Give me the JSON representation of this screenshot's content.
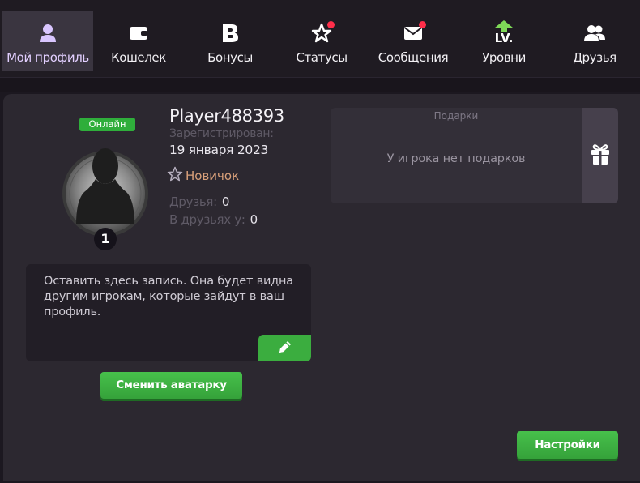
{
  "nav": {
    "items": [
      {
        "label": "Мой профиль",
        "icon": "user-icon",
        "active": true
      },
      {
        "label": "Кошелек",
        "icon": "wallet-icon",
        "active": false
      },
      {
        "label": "Бонусы",
        "icon": "bonus-b-icon",
        "active": false
      },
      {
        "label": "Статусы",
        "icon": "star-icon",
        "active": false,
        "notification": true
      },
      {
        "label": "Сообщения",
        "icon": "envelope-icon",
        "active": false,
        "notification": true
      },
      {
        "label": "Уровни",
        "icon": "level-up-icon",
        "icon_text": "LV.",
        "active": false
      },
      {
        "label": "Друзья",
        "icon": "friends-icon",
        "active": false
      }
    ]
  },
  "profile": {
    "status": "Онлайн",
    "level": "1",
    "name": "Player488393",
    "registered_label": "Зарегистрирован:",
    "registered_date": "19 января 2023",
    "rank": "Новичок",
    "friends_label": "Друзья:",
    "friends_value": "0",
    "friend_of_label": "В друзьях у:",
    "friend_of_value": "0"
  },
  "gifts": {
    "title": "Подарки",
    "empty_text": "У игрока нет подарков"
  },
  "wall": {
    "placeholder": "Оставить здесь запись. Она будет видна другим игрокам, которые зайдут в ваш профиль."
  },
  "buttons": {
    "change_avatar": "Сменить аватарку",
    "settings": "Настройки"
  },
  "colors": {
    "accent_green": "#3bad3f",
    "notification_red": "#ff2e4a",
    "rank_color": "#d9a07a",
    "active_nav_text": "#e2cfff"
  }
}
